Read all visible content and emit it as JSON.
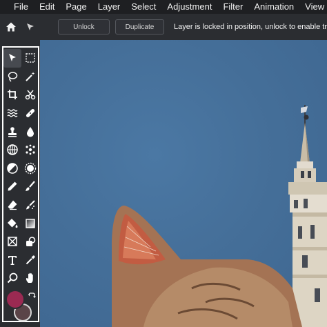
{
  "menu": {
    "items": [
      "File",
      "Edit",
      "Page",
      "Layer",
      "Select",
      "Adjustment",
      "Filter",
      "Animation",
      "View"
    ]
  },
  "options_bar": {
    "home_icon": "home-icon",
    "move_icon": "move-pointer-icon",
    "unlock_label": "Unlock",
    "duplicate_label": "Duplicate",
    "message": "Layer is locked in position, unlock to enable tr"
  },
  "tools": [
    "move-tool-icon",
    "marquee-select-icon",
    "lasso-icon",
    "magic-wand-icon",
    "crop-icon",
    "cut-icon",
    "liquify-icon",
    "healing-bandage-icon",
    "clone-stamp-icon",
    "blur-drop-icon",
    "sponge-icon",
    "spot-heal-icon",
    "dodge-burn-icon",
    "sharpen-icon",
    "pencil-icon",
    "brush-icon",
    "eraser-icon",
    "color-replace-icon",
    "paint-bucket-icon",
    "gradient-icon",
    "shape-icon",
    "shape-fill-icon",
    "text-icon",
    "eyedropper-icon",
    "zoom-icon",
    "hand-icon"
  ],
  "colors": {
    "foreground": "#9b2a52",
    "background": "#5a4448",
    "swap_icon": "swap-arrows-icon",
    "sky": "#456f99"
  }
}
